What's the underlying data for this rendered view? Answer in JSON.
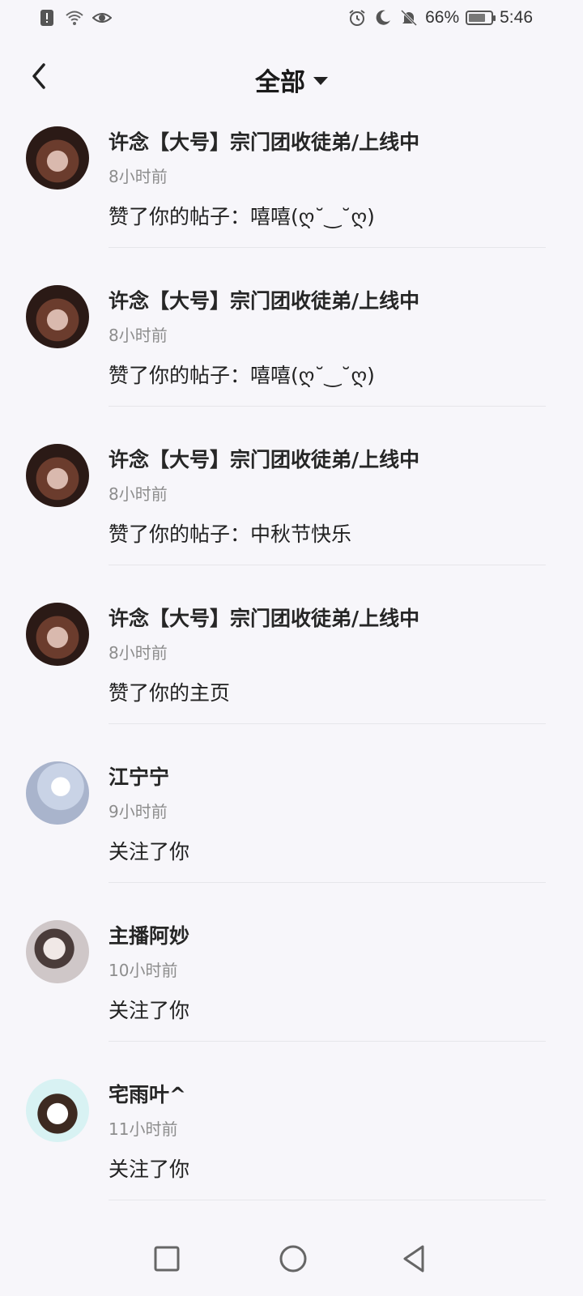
{
  "status_bar": {
    "battery_percent": "66%",
    "time": "5:46",
    "left_icons": [
      "alert-icon",
      "wifi-icon",
      "eye-icon"
    ],
    "right_icons": [
      "alarm-icon",
      "moon-icon",
      "bell-off-icon",
      "battery-icon"
    ]
  },
  "header": {
    "title": "全部",
    "back_icon": "chevron-left-icon",
    "dropdown_icon": "caret-down-icon"
  },
  "notifications": [
    {
      "name": "许念【大号】宗门团收徒弟/上线中",
      "time": "8小时前",
      "action": "赞了你的帖子：嘻嘻(ღ˘‿˘ღ)"
    },
    {
      "name": "许念【大号】宗门团收徒弟/上线中",
      "time": "8小时前",
      "action": "赞了你的帖子：嘻嘻(ღ˘‿˘ღ)"
    },
    {
      "name": "许念【大号】宗门团收徒弟/上线中",
      "time": "8小时前",
      "action": "赞了你的帖子：中秋节快乐"
    },
    {
      "name": "许念【大号】宗门团收徒弟/上线中",
      "time": "8小时前",
      "action": "赞了你的主页"
    },
    {
      "name": "江宁宁",
      "time": "9小时前",
      "action": "关注了你"
    },
    {
      "name": "主播阿妙",
      "time": "10小时前",
      "action": "关注了你"
    },
    {
      "name": "宅雨叶^",
      "time": "11小时前",
      "action": "关注了你"
    }
  ],
  "nav": {
    "icons": [
      "square-recents-icon",
      "circle-home-icon",
      "triangle-back-icon"
    ]
  }
}
